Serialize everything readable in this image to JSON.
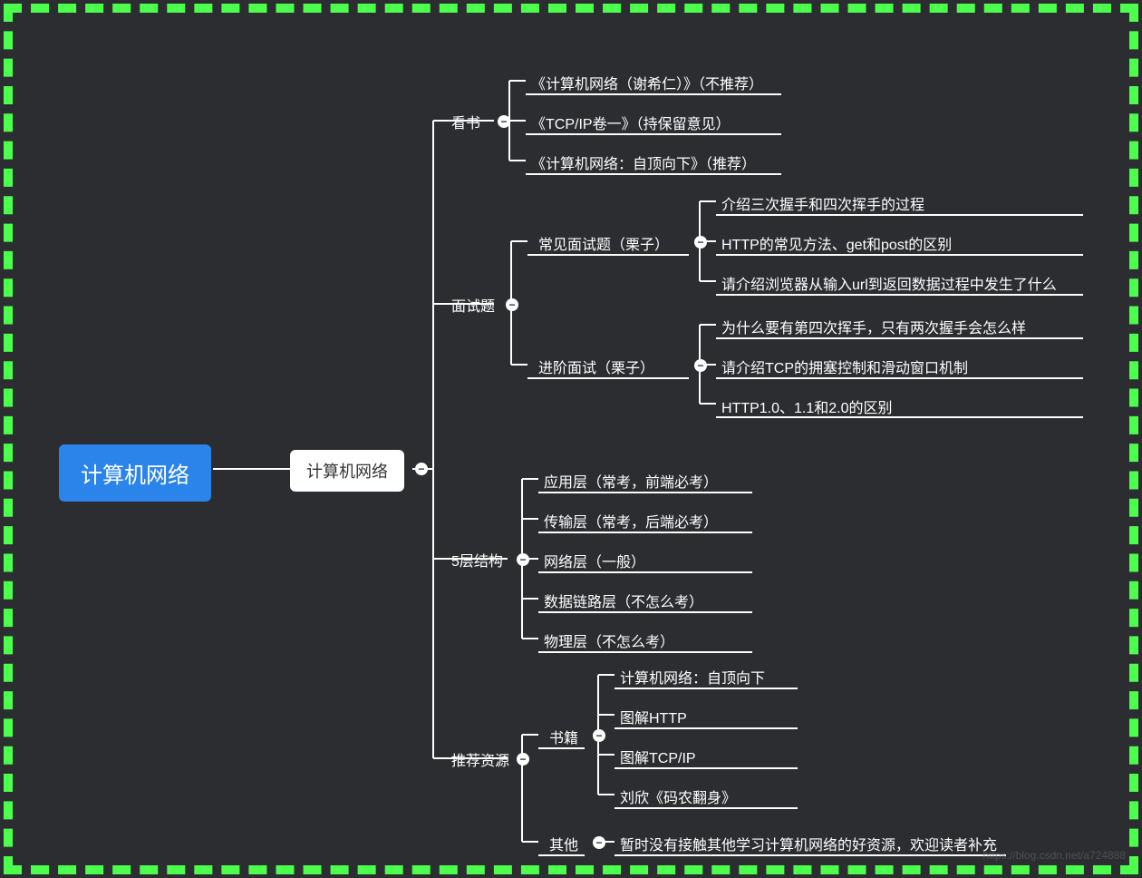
{
  "root": "计算机网络",
  "subRoot": "计算机网络",
  "branches": {
    "books": {
      "label": "看书",
      "items": [
        "《计算机网络（谢希仁）》（不推荐）",
        "《TCP/IP卷一》（持保留意见）",
        "《计算机网络：自顶向下》（推荐）"
      ]
    },
    "interview": {
      "label": "面试题",
      "common": {
        "label": "常见面试题（栗子）",
        "items": [
          "介绍三次握手和四次挥手的过程",
          "HTTP的常见方法、get和post的区别",
          "请介绍浏览器从输入url到返回数据过程中发生了什么"
        ]
      },
      "advanced": {
        "label": "进阶面试（栗子）",
        "items": [
          "为什么要有第四次挥手，只有两次握手会怎么样",
          "请介绍TCP的拥塞控制和滑动窗口机制",
          "HTTP1.0、1.1和2.0的区别"
        ]
      }
    },
    "layers": {
      "label": "5层结构",
      "items": [
        "应用层（常考，前端必考）",
        "传输层（常考，后端必考）",
        "网络层（一般）",
        "数据链路层（不怎么考）",
        "物理层（不怎么考）"
      ]
    },
    "resources": {
      "label": "推荐资源",
      "booksRef": {
        "label": "书籍",
        "items": [
          "计算机网络：自顶向下",
          "图解HTTP",
          "图解TCP/IP",
          "刘欣《码农翻身》"
        ]
      },
      "other": {
        "label": "其他",
        "item": "暂时没有接触其他学习计算机网络的好资源，欢迎读者补充"
      }
    }
  },
  "watermark": "https://blog.csdn.net/a724888",
  "collapseSymbol": "−"
}
